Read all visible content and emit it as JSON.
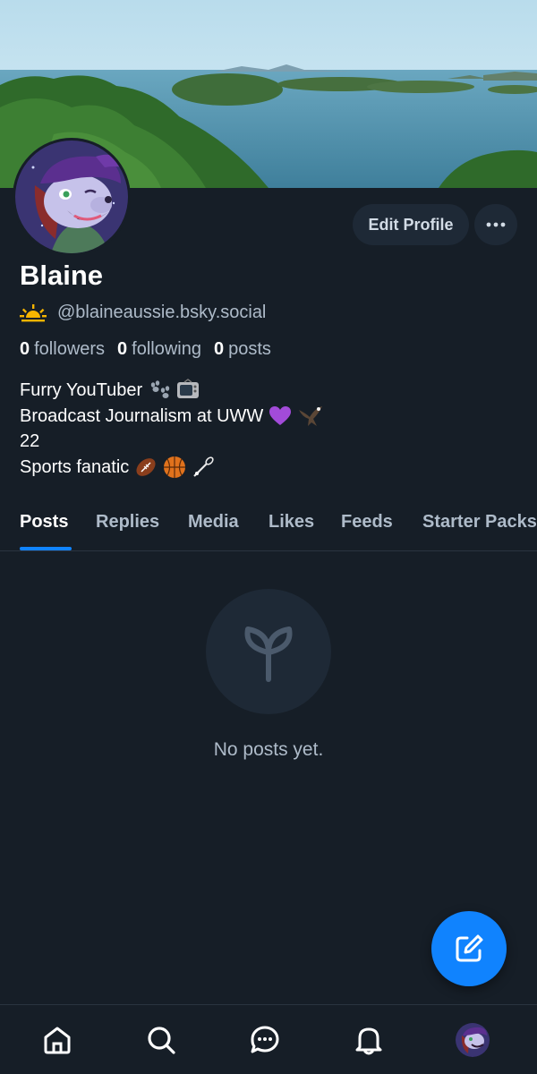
{
  "profile": {
    "display_name": "Blaine",
    "handle": "@blaineaussie.bsky.social",
    "edit_label": "Edit Profile",
    "more_icon": "ellipsis-icon",
    "stats": [
      {
        "count": "0",
        "label": "followers"
      },
      {
        "count": "0",
        "label": "following"
      },
      {
        "count": "0",
        "label": "posts"
      }
    ],
    "bio": [
      "Furry YouTuber",
      "Broadcast Journalism at UWW",
      "22",
      "Sports fanatic"
    ]
  },
  "tabs": [
    {
      "label": "Posts",
      "active": true
    },
    {
      "label": "Replies"
    },
    {
      "label": "Media"
    },
    {
      "label": "Likes"
    },
    {
      "label": "Feeds"
    },
    {
      "label": "Starter Packs"
    }
  ],
  "empty_state": {
    "icon": "seedling-icon",
    "text": "No posts yet."
  },
  "fab": {
    "icon": "compose-icon"
  },
  "bottom_nav": [
    {
      "name": "home",
      "icon": "home-icon"
    },
    {
      "name": "search",
      "icon": "search-icon"
    },
    {
      "name": "chat",
      "icon": "chat-icon"
    },
    {
      "name": "notifications",
      "icon": "bell-icon"
    },
    {
      "name": "profile",
      "icon": "avatar"
    }
  ],
  "colors": {
    "background": "#161e27",
    "accent": "#1083fe",
    "muted_text": "#aebbc9",
    "button_bg": "#1e2936"
  }
}
